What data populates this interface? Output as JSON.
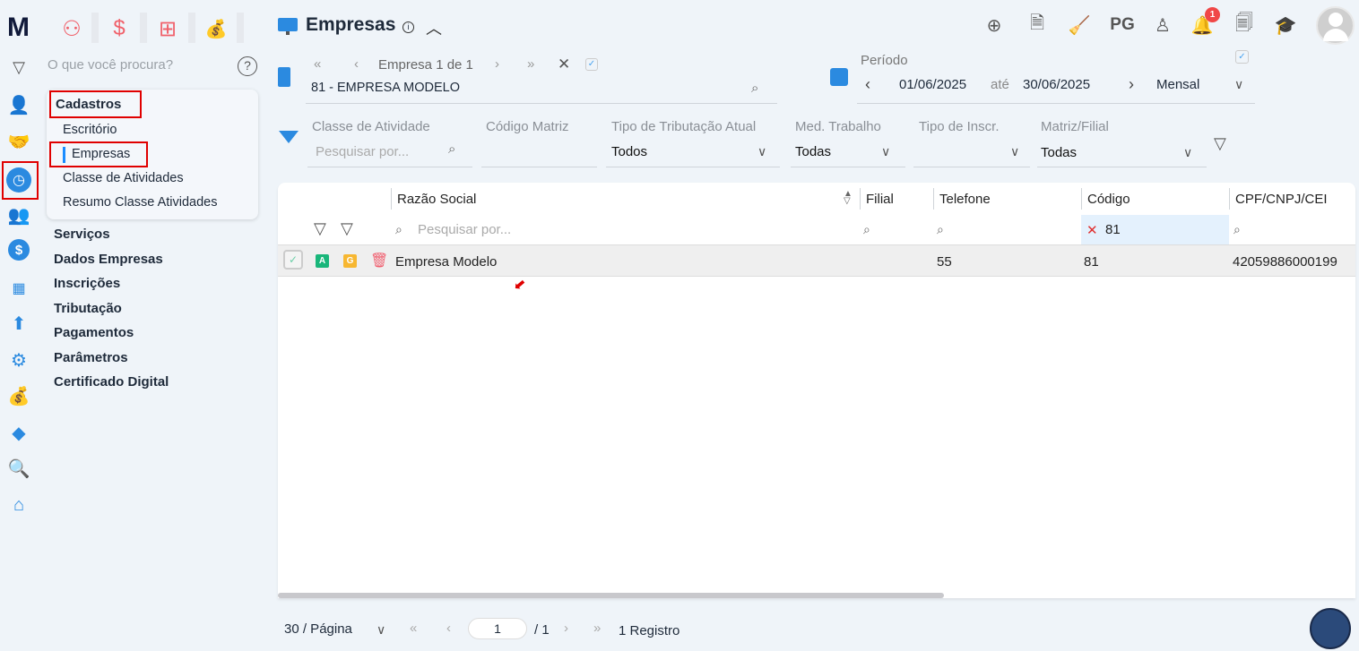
{
  "app": {
    "logo": "M"
  },
  "top_modules": [
    {
      "icon": "users-icon"
    },
    {
      "icon": "dollar-icon"
    },
    {
      "icon": "calculator-icon"
    },
    {
      "icon": "money-bag-icon"
    }
  ],
  "search": {
    "placeholder": "O que você procura?"
  },
  "menu": {
    "section": "Cadastros",
    "sub_items": [
      "Escritório",
      "Empresas",
      "Classe de Atividades",
      "Resumo Classe Atividades"
    ],
    "active": "Empresas",
    "items": [
      "Serviços",
      "Dados Empresas",
      "Inscrições",
      "Tributação",
      "Pagamentos",
      "Parâmetros",
      "Certificado Digital"
    ]
  },
  "header": {
    "title": "Empresas",
    "pg_label": "PG",
    "notification_count": "1"
  },
  "empresa_nav": {
    "label": "Empresa 1 de 1",
    "value": "81 - EMPRESA MODELO"
  },
  "periodo": {
    "label": "Período",
    "from": "01/06/2025",
    "sep": "até",
    "to": "30/06/2025",
    "mode": "Mensal"
  },
  "filters": [
    {
      "label": "Classe de Atividade",
      "value": "",
      "placeholder": "Pesquisar por..."
    },
    {
      "label": "Código Matriz",
      "value": ""
    },
    {
      "label": "Tipo de Tributação Atual",
      "value": "Todos"
    },
    {
      "label": "Med. Trabalho",
      "value": "Todas"
    },
    {
      "label": "Tipo de Inscr.",
      "value": ""
    },
    {
      "label": "Matriz/Filial",
      "value": "Todas"
    }
  ],
  "table": {
    "columns": [
      "Razão Social",
      "Filial",
      "Telefone",
      "Código",
      "CPF/CNPJ/CEI"
    ],
    "search_placeholder": "Pesquisar por...",
    "codigo_filter": "81",
    "rows": [
      {
        "badge_a": "A",
        "badge_g": "G",
        "razao": "Empresa Modelo",
        "filial": "",
        "telefone": "55",
        "codigo": "81",
        "cpf": "42059886000199"
      }
    ]
  },
  "pagination": {
    "per_page": "30 / Página",
    "page": "1",
    "total_pages": "/ 1",
    "records": "1 Registro"
  },
  "colors": {
    "accent": "#2b8ae0",
    "highlight": "#e00000",
    "badge_a": "#19b67a",
    "badge_g": "#f7b731"
  }
}
